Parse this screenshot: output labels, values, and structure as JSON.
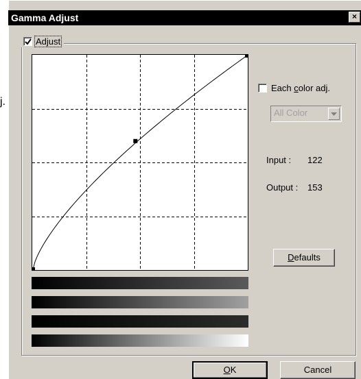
{
  "stray_text": "j.",
  "window": {
    "title": "Gamma Adjust",
    "close_glyph": "×"
  },
  "adjust": {
    "label": "Adjust",
    "checked": true
  },
  "each_color": {
    "prefix": "Each ",
    "accel": "c",
    "suffix": "olor adj.",
    "checked": false
  },
  "color_select": {
    "value": "All Color"
  },
  "info": {
    "input_label": "Input :",
    "input_value": "122",
    "output_label": "Output :",
    "output_value": "153"
  },
  "buttons": {
    "defaults": {
      "accel": "D",
      "rest": "efaults"
    },
    "ok": {
      "accel": "O",
      "rest": "K"
    },
    "cancel": "Cancel"
  },
  "curve": {
    "gamma": 1.4,
    "control_point": {
      "input": 122,
      "output": 153
    },
    "max": 255
  },
  "gradients": [
    "red-channel",
    "green-channel",
    "blue-channel",
    "all-channels"
  ],
  "colors": {
    "dialog_bg": "#d4d0c8",
    "titlebar_bg": "#000000"
  }
}
